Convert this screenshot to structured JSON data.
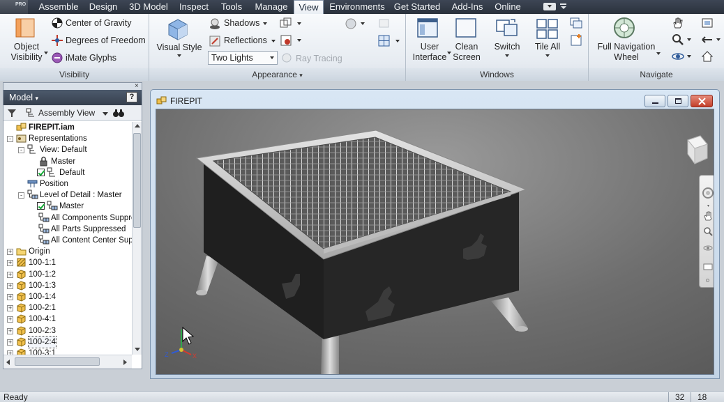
{
  "app": {
    "badge": "PRO"
  },
  "tabs": [
    {
      "label": "Assemble",
      "active": false
    },
    {
      "label": "Design",
      "active": false
    },
    {
      "label": "3D Model",
      "active": false
    },
    {
      "label": "Inspect",
      "active": false
    },
    {
      "label": "Tools",
      "active": false
    },
    {
      "label": "Manage",
      "active": false
    },
    {
      "label": "View",
      "active": true
    },
    {
      "label": "Environments",
      "active": false
    },
    {
      "label": "Get Started",
      "active": false
    },
    {
      "label": "Add-Ins",
      "active": false
    },
    {
      "label": "Online",
      "active": false
    }
  ],
  "ribbon": {
    "visibility": {
      "title": "Visibility",
      "object_visibility": "Object\nVisibility",
      "center_of_gravity": "Center of Gravity",
      "degrees_of_freedom": "Degrees of Freedom",
      "imate_glyphs": "iMate Glyphs"
    },
    "appearance": {
      "title": "Appearance",
      "visual_style": "Visual Style",
      "shadows": "Shadows",
      "reflections": "Reflections",
      "lighting": "Two Lights",
      "ray_tracing": "Ray Tracing"
    },
    "windows": {
      "title": "Windows",
      "user_interface": "User\nInterface",
      "clean_screen": "Clean\nScreen",
      "switch": "Switch",
      "tile_all": "Tile All"
    },
    "navigate": {
      "title": "Navigate",
      "full_nav_wheel": "Full Navigation\nWheel"
    }
  },
  "browser": {
    "title": "Model",
    "help": "?",
    "view_selector": "Assembly View",
    "close": "×",
    "tree": [
      {
        "label": "FIREPIT.iam",
        "depth": 0,
        "icon": "assembly-icon",
        "bold": true
      },
      {
        "label": "Representations",
        "depth": 0,
        "icon": "representations-icon",
        "exp": "-"
      },
      {
        "label": "View: Default",
        "depth": 1,
        "icon": "view-rep-icon",
        "exp": "-"
      },
      {
        "label": "Master",
        "depth": 2,
        "icon": "lock-icon"
      },
      {
        "label": "Default",
        "depth": 2,
        "icon": "view-rep-icon",
        "check": true
      },
      {
        "label": "Position",
        "depth": 1,
        "icon": "position-icon"
      },
      {
        "label": "Level of Detail : Master",
        "depth": 1,
        "icon": "lod-icon",
        "exp": "-"
      },
      {
        "label": "Master",
        "depth": 2,
        "icon": "lod-icon",
        "check": true
      },
      {
        "label": "All Components Suppressed",
        "depth": 2,
        "icon": "lod-icon"
      },
      {
        "label": "All Parts Suppressed",
        "depth": 2,
        "icon": "lod-icon"
      },
      {
        "label": "All Content Center Suppressed",
        "depth": 2,
        "icon": "lod-icon"
      },
      {
        "label": "Origin",
        "depth": 0,
        "icon": "folder-icon",
        "exp": "+"
      },
      {
        "label": "100-1:1",
        "depth": 0,
        "icon": "grounded-part-icon",
        "exp": "+"
      },
      {
        "label": "100-1:2",
        "depth": 0,
        "icon": "part-icon",
        "exp": "+"
      },
      {
        "label": "100-1:3",
        "depth": 0,
        "icon": "part-icon",
        "exp": "+"
      },
      {
        "label": "100-1:4",
        "depth": 0,
        "icon": "part-icon",
        "exp": "+"
      },
      {
        "label": "100-2:1",
        "depth": 0,
        "icon": "part-icon",
        "exp": "+"
      },
      {
        "label": "100-4:1",
        "depth": 0,
        "icon": "part-icon",
        "exp": "+"
      },
      {
        "label": "100-2:3",
        "depth": 0,
        "icon": "part-icon",
        "exp": "+"
      },
      {
        "label": "100-2:4",
        "depth": 0,
        "icon": "part-icon",
        "exp": "+",
        "selected": true
      },
      {
        "label": "100-3:1",
        "depth": 0,
        "icon": "part-icon",
        "exp": "+"
      }
    ]
  },
  "document": {
    "title": "FIREPIT",
    "triad": {
      "z": "Z",
      "x": "X"
    }
  },
  "status": {
    "text": "Ready",
    "a": "32",
    "b": "18"
  },
  "colors": {
    "tab_bar": "#2f3743",
    "ribbon_bg": "#eef2f6",
    "viewport_bg": "#6e6e6e",
    "accent": "#3f6fb5"
  }
}
